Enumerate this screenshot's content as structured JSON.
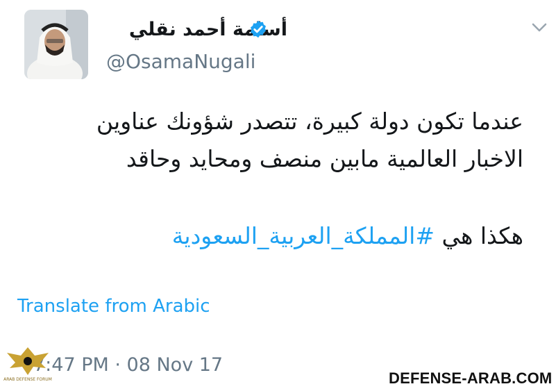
{
  "tweet": {
    "display_name": "أسامة أحمد نقلي",
    "handle": "@OsamaNugali",
    "text_lines": [
      "عندما تكون دولة كبيرة، تتصدر شؤونك عناوين",
      "الاخبار العالمية مابين منصف ومحايد وحاقد"
    ],
    "text_line3_plain": "هكذا هي ",
    "hashtag": "#المملكة_العربية_السعودية",
    "translate_label": "Translate from Arabic",
    "timestamp": "7:47 PM · 08 Nov 17"
  },
  "icons": {
    "verified": "verified-badge-icon",
    "menu": "chevron-down-icon",
    "avatar": "profile-photo"
  },
  "watermark": {
    "site": "DEFENSE-ARAB.COM",
    "logo_caption": "ARAB DEFENSE FORUM"
  },
  "colors": {
    "link": "#1da1f2",
    "secondary": "#657786",
    "primary_text": "#14171a",
    "verified": "#1da1f2"
  }
}
